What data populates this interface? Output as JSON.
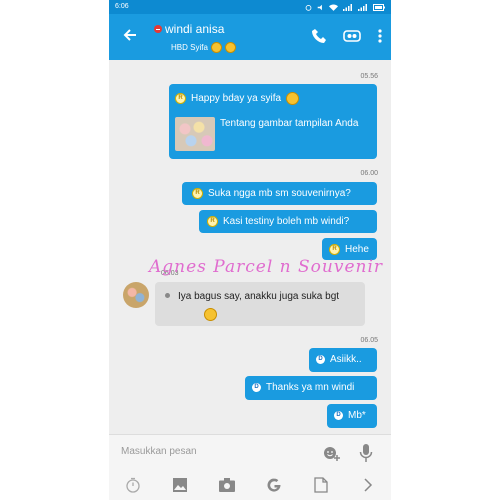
{
  "status": {
    "time": "6:06"
  },
  "header": {
    "contact_name": "windi anisa",
    "status_text": "HBD Syifa"
  },
  "messages": [
    {
      "time": "05.56",
      "text": "Happy bday ya syifa",
      "badge": "R"
    },
    {
      "link_text": "Tentang gambar tampilan Anda",
      "badge": "R"
    },
    {
      "time": "06.00",
      "text": "Suka ngga mb sm souvenirnya?",
      "badge": "R"
    },
    {
      "text": "Kasi testiny boleh mb windi?",
      "badge": "R"
    },
    {
      "text": "Hehe",
      "badge": "R"
    },
    {
      "time": "06.03",
      "text": "Iya bagus say, anakku juga suka bgt"
    },
    {
      "time": "06.05",
      "text": "Asiikk..",
      "badge": "D"
    },
    {
      "text": "Thanks ya mn windi",
      "badge": "D"
    },
    {
      "text": "Mb*",
      "badge": "D"
    }
  ],
  "watermark": "Agnes Parcel n Souvenir",
  "input": {
    "placeholder": "Masukkan pesan"
  },
  "colors": {
    "accent": "#1a9be0",
    "statusbar": "#0d8ad1"
  }
}
